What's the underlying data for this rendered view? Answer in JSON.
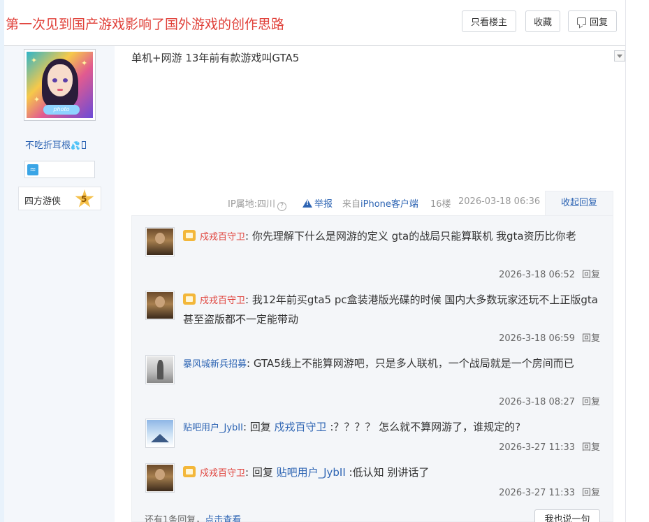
{
  "thread": {
    "title": "第一次见到国产游戏影响了国外游戏的创作思路",
    "buttons": {
      "only_op": "只看楼主",
      "favorite": "收藏",
      "reply": "回复"
    }
  },
  "author": {
    "name": "不吃折耳根",
    "level_name": "四方游侠",
    "level": "5"
  },
  "post": {
    "content": "单机+网游 13年前有款游戏叫GTA5",
    "ip": "IP属地:四川",
    "report": "举报",
    "client_prefix": "来自",
    "client": "iPhone客户端",
    "floor": "16楼",
    "time": "2026-03-18 06:36",
    "collapse_replies": "收起回复"
  },
  "replies": [
    {
      "user": "戍戎百守卫",
      "user_color": "#e0413a",
      "vip": true,
      "prefix": ": ",
      "reply_to": "",
      "text": "你先理解下什么是网游的定义 gta的战局只能算联机 我gta资历比你老",
      "time": "2026-3-18 06:52",
      "reply_label": "回复"
    },
    {
      "user": "戍戎百守卫",
      "user_color": "#e0413a",
      "vip": true,
      "prefix": ": ",
      "reply_to": "",
      "text": "我12年前买gta5 pc盒装港版光碟的时候 国内大多数玩家还玩不上正版gta 甚至盗版都不一定能带动",
      "time": "2026-3-18 06:59",
      "reply_label": "回复"
    },
    {
      "user": "暴风城新兵招募",
      "user_color": "#2d64b3",
      "vip": false,
      "prefix": ": ",
      "reply_to": "",
      "text": "GTA5线上不能算网游吧，只是多人联机，一个战局就是一个房间而已",
      "time": "2026-3-18 08:27",
      "reply_label": "回复"
    },
    {
      "user": "贴吧用户_JybII",
      "user_color": "#2d64b3",
      "vip": false,
      "prefix": ": 回复 ",
      "reply_to": "戍戎百守卫",
      "text": " :？？？？ 怎么就不算网游了，谁规定的?",
      "time": "2026-3-27 11:33",
      "reply_label": "回复"
    },
    {
      "user": "戍戎百守卫",
      "user_color": "#e0413a",
      "vip": true,
      "prefix": ": 回复 ",
      "reply_to": "贴吧用户_JybII",
      "text": " :低认知 别讲话了",
      "time": "2026-3-27 11:33",
      "reply_label": "回复"
    }
  ],
  "footer": {
    "more_prefix": "还有1条回复，",
    "more_link": "点击查看",
    "say_button": "我也说一句"
  }
}
